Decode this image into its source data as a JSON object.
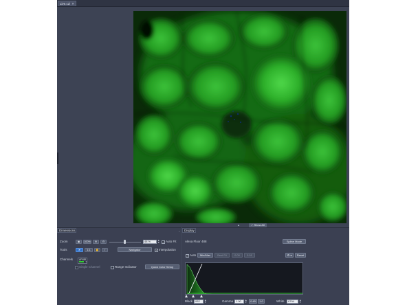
{
  "window": {
    "tab_label": "Live.czi"
  },
  "viewer": {
    "show_all_label": "Show All"
  },
  "dimensions_panel": {
    "tab_label": "Dimensions",
    "zoom_label": "Zoom",
    "zoom_value": "48 %",
    "zoom_100_label": "100%",
    "auto_fit_label": "Auto Fit",
    "auto_fit_checked": true,
    "tools_label": "Tools",
    "tools_1x1_label": "1:1",
    "navigator_label": "Navigator",
    "interpolation_label": "Interpolation",
    "interpolation_checked": true,
    "channels_label": "Channels",
    "channel_name": "AF488",
    "channel_color": "#32d232",
    "single_channel_label": "Single Channel",
    "range_indicator_label": "Range Indicator",
    "quick_color_setup_label": "Quick Color Setup"
  },
  "display_panel": {
    "tab_label": "Display",
    "channel_title": "Alexa Fluor 488",
    "spline_mode_label": "Spline Mode",
    "auto_label": "Auto",
    "auto_checked": true,
    "minmax_label": "Min/Max",
    "bestfit_label": "Best Fit",
    "val1_label": "0.00",
    "val2_label": "0.01",
    "settings_icon_label": "⚙ ▾",
    "reset_label": "Reset",
    "black_label": "Black",
    "black_value": "932",
    "gamma_label": "Gamma",
    "gamma_value": "1.00",
    "gamma_low": "0.45",
    "gamma_high": "1.0",
    "white_label": "White",
    "white_value": "8794"
  },
  "colors": {
    "accent": "#2f6fc6",
    "fluorescence": "#32d232",
    "panel_bg": "#3b4052"
  }
}
